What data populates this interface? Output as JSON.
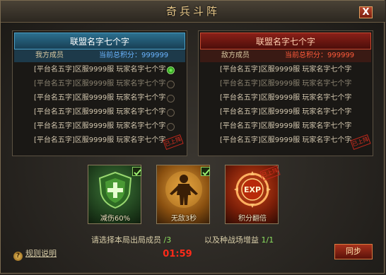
{
  "window": {
    "title": "奇兵斗阵",
    "close_label": "X"
  },
  "left_panel": {
    "alliance_name": "联盟名字七个字",
    "members_label": "我方成员",
    "score_label": "当前总积分：",
    "score_value": "999999",
    "rows": [
      {
        "text": "[平台名五字]区服9999服 玩家名字七个字",
        "dim": false,
        "selected": true
      },
      {
        "text": "[平台名五字]区服9999服 玩家名字七个字",
        "dim": true,
        "selected": false
      },
      {
        "text": "[平台名五字]区服9999服 玩家名字七个字",
        "dim": false,
        "selected": false
      },
      {
        "text": "[平台名五字]区服9999服 玩家名字七个字",
        "dim": false,
        "selected": false
      },
      {
        "text": "[平台名五字]区服9999服 玩家名字七个字",
        "dim": false,
        "selected": false
      },
      {
        "text": "[平台名五字]区服9999服 玩家名字七个字",
        "dim": false,
        "selected": false
      }
    ],
    "stamp": "已上阵"
  },
  "right_panel": {
    "alliance_name": "联盟名字七个字",
    "members_label": "敌方成员",
    "score_label": "当前总积分：",
    "score_value": "999999",
    "rows": [
      {
        "text": "[平台名五字]区服9999服 玩家名字七个字",
        "dim": false
      },
      {
        "text": "[平台名五字]区服9999服 玩家名字七个字",
        "dim": true
      },
      {
        "text": "[平台名五字]区服9999服 玩家名字七个字",
        "dim": false
      },
      {
        "text": "[平台名五字]区服9999服 玩家名字七个字",
        "dim": false
      },
      {
        "text": "[平台名五字]区服9999服 玩家名字七个字",
        "dim": false
      },
      {
        "text": "[平台名五字]区服9999服 玩家名字七个字",
        "dim": false
      }
    ],
    "stamp": "已上阵"
  },
  "skills": [
    {
      "label": "减伤60%",
      "icon": "shield-plus-icon",
      "checked": true
    },
    {
      "label": "无敌3秒",
      "icon": "golden-warrior-icon",
      "checked": true
    },
    {
      "label": "积分翻倍",
      "icon": "exp-icon",
      "icon_text": "EXP",
      "checked": false,
      "stamp": "已上阵"
    }
  ],
  "info": {
    "select_members_text": "请选择本局出局成员",
    "members_count": "/3",
    "buff_text": "以及种战场增益",
    "buff_count": "1/1"
  },
  "footer": {
    "rules_icon": "?",
    "rules_label": "规则说明",
    "timer": "01:59",
    "sync_label": "同步"
  },
  "colors": {
    "accent_gold": "#e9c98a",
    "ally_blue": "#2c6f8e",
    "enemy_red": "#8a2018",
    "timer_red": "#ff2a1a",
    "check_green": "#8de060"
  }
}
